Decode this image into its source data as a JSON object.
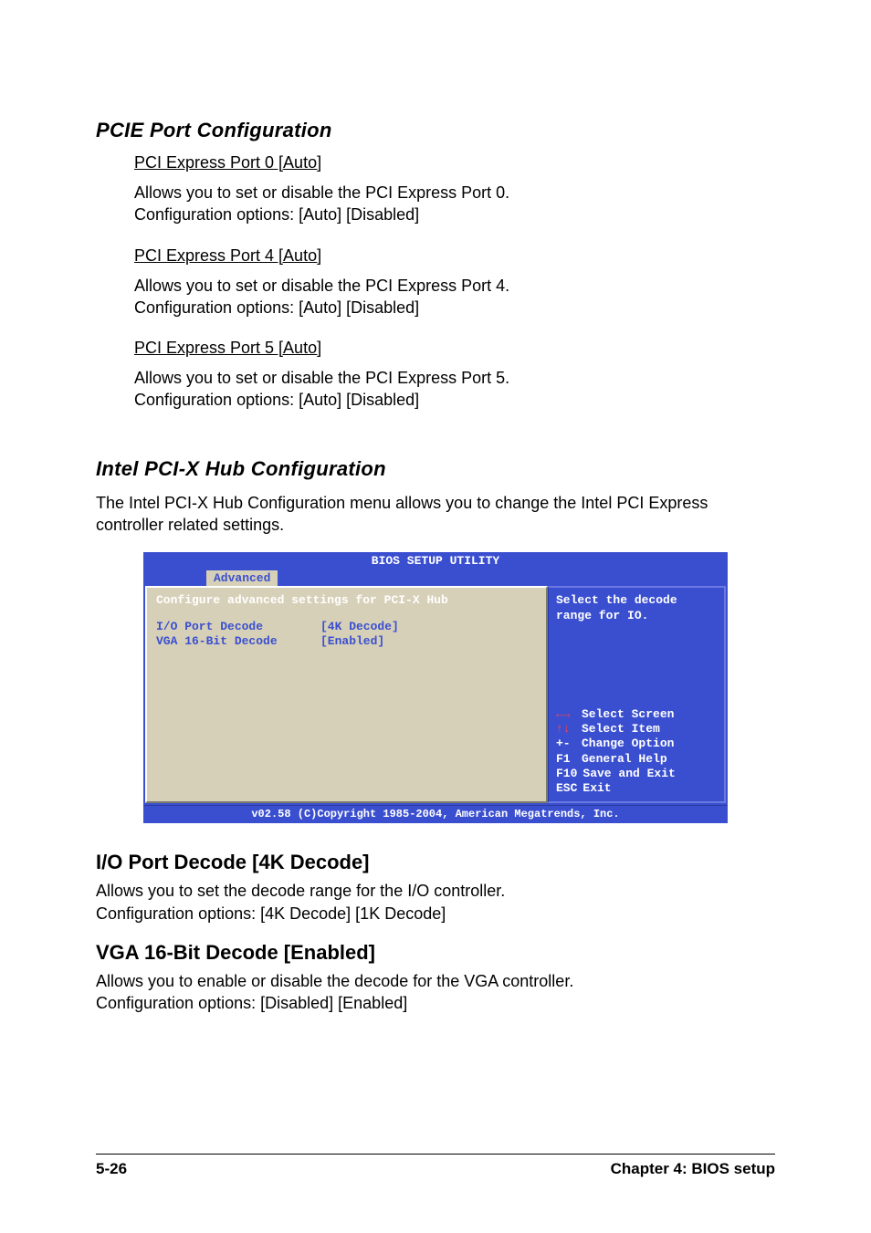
{
  "section_pcie": {
    "title": "PCIE Port Configuration",
    "items": [
      {
        "heading": "PCI Express Port 0 [Auto]",
        "desc1": "Allows you to set or disable the PCI Express Port 0.",
        "desc2": "Configuration options: [Auto] [Disabled]"
      },
      {
        "heading": "PCI Express Port 4 [Auto]",
        "desc1": "Allows you to set or disable the PCI Express Port 4.",
        "desc2": "Configuration options: [Auto] [Disabled]"
      },
      {
        "heading": "PCI Express Port 5 [Auto]",
        "desc1": "Allows you to set or disable the PCI Express Port 5.",
        "desc2": "Configuration options: [Auto] [Disabled]"
      }
    ]
  },
  "section_pcix": {
    "title": "Intel PCI-X Hub Configuration",
    "intro": "The Intel PCI-X Hub Configuration menu allows you to change the Intel PCI Express controller related settings."
  },
  "bios": {
    "title": "BIOS SETUP UTILITY",
    "tab": "Advanced",
    "heading": "Configure advanced settings for PCI-X Hub",
    "rows": [
      {
        "label": "I/O Port Decode",
        "value": "[4K Decode]"
      },
      {
        "label": "VGA 16-Bit  Decode",
        "value": "[Enabled]"
      }
    ],
    "help": "Select the decode range for IO.",
    "keys": [
      {
        "sym": "←→",
        "label": "Select Screen",
        "red": true
      },
      {
        "sym": "↑↓",
        "label": "Select Item",
        "red": true
      },
      {
        "sym": "+-",
        "label": "Change Option"
      },
      {
        "sym": "F1",
        "label": "General Help"
      },
      {
        "sym": "F10",
        "label": "Save and Exit"
      },
      {
        "sym": "ESC",
        "label": "Exit"
      }
    ],
    "footer": "v02.58 (C)Copyright 1985-2004, American Megatrends, Inc."
  },
  "section_io": {
    "title": "I/O Port Decode [4K Decode]",
    "p1": "Allows you to set the decode range for the I/O controller.",
    "p2": "Configuration options: [4K Decode] [1K Decode]"
  },
  "section_vga": {
    "title": "VGA 16-Bit Decode [Enabled]",
    "p1": "Allows you to enable or disable the decode for the VGA controller.",
    "p2": "Configuration options: [Disabled] [Enabled]"
  },
  "footer": {
    "left": "5-26",
    "right": "Chapter 4: BIOS setup"
  }
}
